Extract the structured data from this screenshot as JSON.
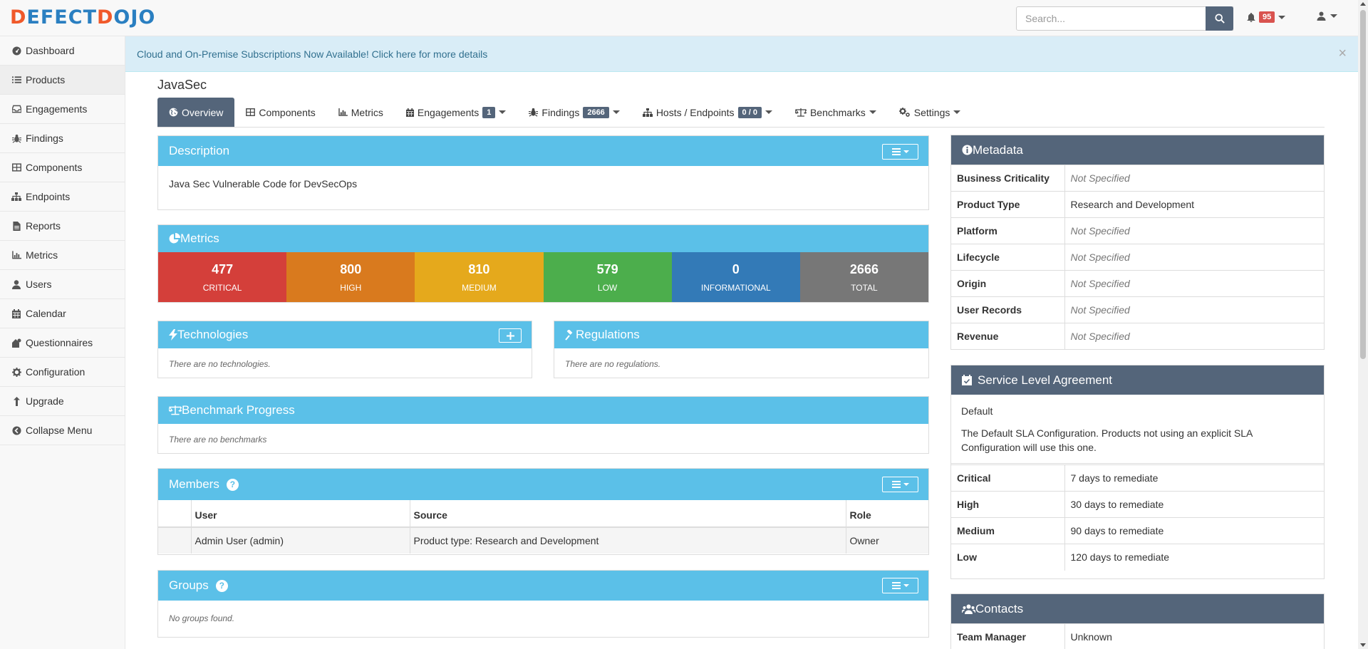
{
  "brand": {
    "part1": "D",
    "part2": "EFECT",
    "part3": "D",
    "part4": "OJO"
  },
  "search": {
    "placeholder": "Search..."
  },
  "notifications": {
    "count": "95"
  },
  "sidebar": {
    "items": [
      {
        "label": "Dashboard",
        "icon": "dashboard-icon"
      },
      {
        "label": "Products",
        "icon": "list-icon"
      },
      {
        "label": "Engagements",
        "icon": "inbox-icon"
      },
      {
        "label": "Findings",
        "icon": "bug-icon"
      },
      {
        "label": "Components",
        "icon": "table-icon"
      },
      {
        "label": "Endpoints",
        "icon": "sitemap-icon"
      },
      {
        "label": "Reports",
        "icon": "file-icon"
      },
      {
        "label": "Metrics",
        "icon": "chart-icon"
      },
      {
        "label": "Users",
        "icon": "user-icon"
      },
      {
        "label": "Calendar",
        "icon": "calendar-icon"
      },
      {
        "label": "Questionnaires",
        "icon": "questionnaire-icon"
      },
      {
        "label": "Configuration",
        "icon": "gear-icon"
      },
      {
        "label": "Upgrade",
        "icon": "upgrade-icon"
      },
      {
        "label": "Collapse Menu",
        "icon": "collapse-icon"
      }
    ]
  },
  "alert": {
    "text": "Cloud and On-Premise Subscriptions Now Available! Click here for more details",
    "close": "×"
  },
  "page": {
    "title": "JavaSec"
  },
  "tabs": {
    "overview": "Overview",
    "components": "Components",
    "metrics": "Metrics",
    "engagements": "Engagements",
    "engagements_count": "1",
    "findings": "Findings",
    "findings_count": "2666",
    "hosts": "Hosts / Endpoints",
    "hosts_count": "0 / 0",
    "benchmarks": "Benchmarks",
    "settings": "Settings"
  },
  "description": {
    "title": "Description",
    "text": "Java Sec Vulnerable Code for DevSecOps"
  },
  "metrics": {
    "title": "Metrics",
    "items": [
      {
        "value": "477",
        "label": "CRITICAL",
        "color": "#d43f3a"
      },
      {
        "value": "800",
        "label": "HIGH",
        "color": "#d97a1e"
      },
      {
        "value": "810",
        "label": "MEDIUM",
        "color": "#e5a91c"
      },
      {
        "value": "579",
        "label": "LOW",
        "color": "#4cae4c"
      },
      {
        "value": "0",
        "label": "INFORMATIONAL",
        "color": "#337ab7"
      },
      {
        "value": "2666",
        "label": "TOTAL",
        "color": "#777777"
      }
    ]
  },
  "technologies": {
    "title": "Technologies",
    "empty": "There are no technologies."
  },
  "regulations": {
    "title": "Regulations",
    "empty": "There are no regulations."
  },
  "benchmark": {
    "title": "Benchmark Progress",
    "empty": "There are no benchmarks"
  },
  "members": {
    "title": "Members",
    "headers": [
      "User",
      "Source",
      "Role"
    ],
    "rows": [
      {
        "user": "Admin User (admin)",
        "source": "Product type: Research and Development",
        "role": "Owner"
      }
    ]
  },
  "groups": {
    "title": "Groups",
    "empty": "No groups found."
  },
  "metadata": {
    "title": "Metadata",
    "rows": [
      {
        "key": "Business Criticality",
        "value": "Not Specified"
      },
      {
        "key": "Product Type",
        "value": "Research and Development"
      },
      {
        "key": "Platform",
        "value": "Not Specified"
      },
      {
        "key": "Lifecycle",
        "value": "Not Specified"
      },
      {
        "key": "Origin",
        "value": "Not Specified"
      },
      {
        "key": "User Records",
        "value": "Not Specified"
      },
      {
        "key": "Revenue",
        "value": "Not Specified"
      }
    ]
  },
  "sla": {
    "title": "Service Level Agreement",
    "name": "Default",
    "desc": "The Default SLA Configuration. Products not using an explicit SLA Configuration will use this one.",
    "rows": [
      {
        "key": "Critical",
        "value": "7 days to remediate"
      },
      {
        "key": "High",
        "value": "30 days to remediate"
      },
      {
        "key": "Medium",
        "value": "90 days to remediate"
      },
      {
        "key": "Low",
        "value": "120 days to remediate"
      }
    ]
  },
  "contacts": {
    "title": "Contacts",
    "rows": [
      {
        "key": "Team Manager",
        "value": "Unknown"
      }
    ]
  }
}
